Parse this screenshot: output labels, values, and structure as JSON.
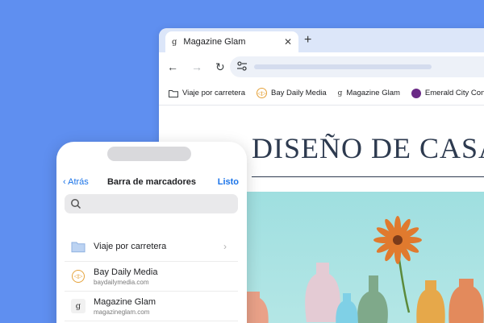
{
  "browser": {
    "tab": {
      "favicon": "g",
      "title": "Magazine Glam"
    },
    "toolbar": {
      "back_icon": "←",
      "forward_icon": "→",
      "reload_icon": "↻"
    },
    "bookmarks": [
      {
        "label": "Viaje por carretera",
        "icon": "folder-icon"
      },
      {
        "label": "Bay Daily Media",
        "icon": "bay-daily-media-icon"
      },
      {
        "label": "Magazine Glam",
        "icon": "magazine-glam-icon"
      },
      {
        "label": "Emerald City Cones",
        "icon": "emerald-city-cones-icon"
      }
    ],
    "page": {
      "heading": "DISEÑO DE CASA"
    }
  },
  "phone": {
    "nav": {
      "back_label": "Atrás",
      "title": "Barra de marcadores",
      "done_label": "Listo"
    },
    "items": [
      {
        "name": "Viaje por carretera",
        "url": "",
        "icon": "folder-icon"
      },
      {
        "name": "Bay Daily Media",
        "url": "baydailymedia.com",
        "icon": "bay-daily-media-icon"
      },
      {
        "name": "Magazine Glam",
        "url": "magazineglam.com",
        "icon": "magazine-glam-icon"
      }
    ]
  },
  "colors": {
    "background": "#5f8ff0",
    "accent_blue": "#1a73e8",
    "bay_orange": "#e5a23a",
    "emerald_purple": "#6a2a86",
    "heading_navy": "#2d3a4f"
  }
}
